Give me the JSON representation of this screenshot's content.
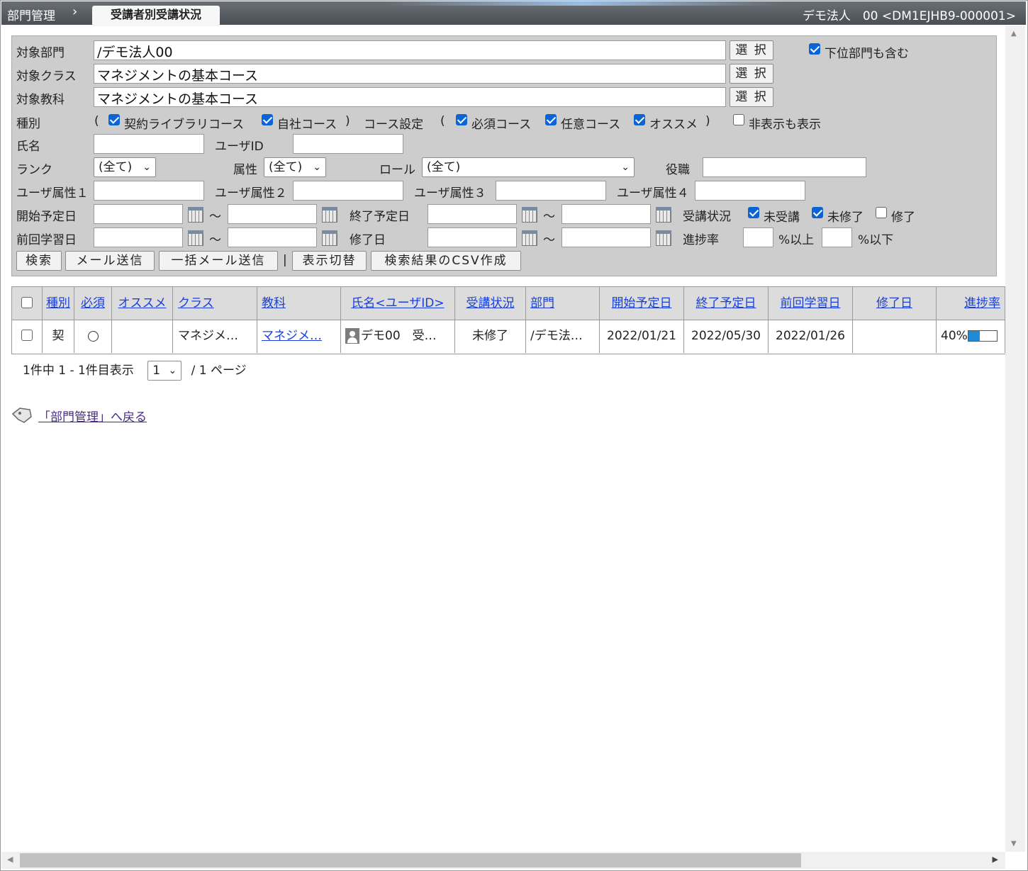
{
  "header": {
    "breadcrumb": "部門管理",
    "active_tab": "受講者別受講状況",
    "user_info": "デモ法人　00 <DM1EJHB9-000001>"
  },
  "filters": {
    "department_label": "対象部門",
    "department_value": "/デモ法人00",
    "class_label": "対象クラス",
    "class_value": "マネジメントの基本コース",
    "subject_label": "対象教科",
    "subject_value": "マネジメントの基本コース",
    "select_label": "選 択",
    "include_sub_label": "下位部門も含む",
    "include_sub_checked": true,
    "type_label": "種別",
    "open_paren": "(",
    "close_paren": ")",
    "contract_library_label": "契約ライブラリコース",
    "own_course_label": "自社コース",
    "course_setting_label": "コース設定",
    "required_label": "必須コース",
    "optional_label": "任意コース",
    "recommended_label": "オススメ",
    "show_hidden_label": "非表示も表示",
    "name_label": "氏名",
    "userid_label": "ユーザID",
    "rank_label": "ランク",
    "rank_value": "(全て)",
    "attribute_label": "属性",
    "attribute_value": "(全て)",
    "role_label": "ロール",
    "role_value": "(全て)",
    "position_label": "役職",
    "user_attr1_label": "ユーザ属性１",
    "user_attr2_label": "ユーザ属性２",
    "user_attr3_label": "ユーザ属性３",
    "user_attr4_label": "ユーザ属性４",
    "start_date_label": "開始予定日",
    "end_date_label": "終了予定日",
    "tilde": "～",
    "status_label": "受講状況",
    "not_started_label": "未受講",
    "not_completed_label": "未修了",
    "completed_label": "修了",
    "last_study_label": "前回学習日",
    "completion_date_label": "修了日",
    "progress_label": "進捗率",
    "pct_above": "%以上",
    "pct_below": "%以下"
  },
  "actions": {
    "search": "検索",
    "send_mail": "メール送信",
    "bulk_mail": "一括メール送信",
    "separator": "|",
    "toggle_view": "表示切替",
    "csv": "検索結果のCSV作成"
  },
  "table": {
    "headers": [
      "種別",
      "必須",
      "オススメ",
      "クラス",
      "教科",
      "氏名<ユーザID>",
      "受講状況",
      "部門",
      "開始予定日",
      "終了予定日",
      "前回学習日",
      "修了日",
      "進捗率"
    ],
    "rows": [
      {
        "type": "契",
        "class": "マネジメ…",
        "subject": "マネジメ…",
        "name": "デモ00　受…",
        "status": "未修了",
        "department": "/デモ法…",
        "start": "2022/01/21",
        "end": "2022/05/30",
        "last": "2022/01/26",
        "completed": "",
        "progress_text": "40%",
        "progress": 0.4
      }
    ]
  },
  "pager": {
    "summary": "1件中 1 - 1件目表示",
    "page": "1",
    "total": "/ 1 ページ"
  },
  "back_link": "「部門管理」へ戻る",
  "colors": {
    "link": "#1a3fd6",
    "checkbox": "#0a64d6",
    "progress": "#1f8ad8"
  }
}
